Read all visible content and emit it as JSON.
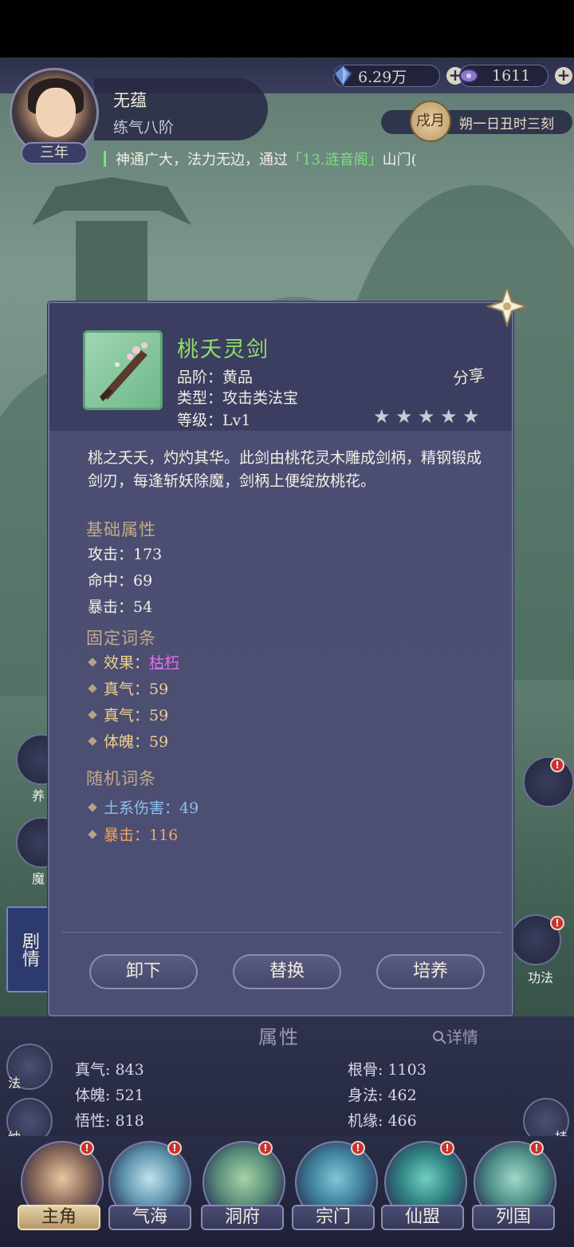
{
  "currency": {
    "spirit_stones": "6.29万",
    "jade": "1611"
  },
  "player": {
    "name": "无蕴",
    "realm": "练气八阶",
    "age": "三年"
  },
  "calendar": {
    "month": "戌月",
    "time": "朔一日丑时三刻"
  },
  "marquee": {
    "prefix": "神通广大，法力无边，通过",
    "highlight": "「13.涟音阁」",
    "suffix": "山门("
  },
  "item": {
    "name": "桃夭灵剑",
    "grade_line": "品阶：黄品",
    "type_line": "类型：攻击类法宝",
    "level_line": "等级：Lv1",
    "share_label": "分享",
    "stars": 5,
    "description": "桃之夭夭，灼灼其华。此剑由桃花灵木雕成剑柄，精钢锻成剑刃，每逢斩妖除魔，剑柄上便绽放桃花。",
    "base_title": "基础属性",
    "base_stats": [
      "攻击：173",
      "命中：69",
      "暴击：54"
    ],
    "fixed_title": "固定词条",
    "fixed_effect_label": "效果：",
    "fixed_effect_value": "枯朽",
    "fixed_entries": [
      "真气：59",
      "真气：59",
      "体魄：59"
    ],
    "random_title": "随机词条",
    "random_entries": [
      "土系伤害：49",
      "暴击：116"
    ]
  },
  "actions": {
    "unequip": "卸下",
    "replace": "替换",
    "cultivate": "培养"
  },
  "attributes": {
    "title": "属性",
    "detail_label": "详情",
    "left": [
      "真气: 843",
      "体魄: 521",
      "悟性: 818"
    ],
    "right": [
      "根骨: 1103",
      "身法: 462",
      "机缘: 466"
    ]
  },
  "side": {
    "fa": "法",
    "na": "纳",
    "gua": "挂",
    "story": "剧情",
    "gong": "功法",
    "yang": "养",
    "mo": "魔"
  },
  "nav": [
    "主角",
    "气海",
    "洞府",
    "宗门",
    "仙盟",
    "列国"
  ],
  "colors": {
    "item_name": "#8fdc6a",
    "effect_link": "#e070e8",
    "random_blue": "#8ec0ee",
    "random_orange": "#f2a560",
    "marquee_highlight": "#7ee07e"
  }
}
